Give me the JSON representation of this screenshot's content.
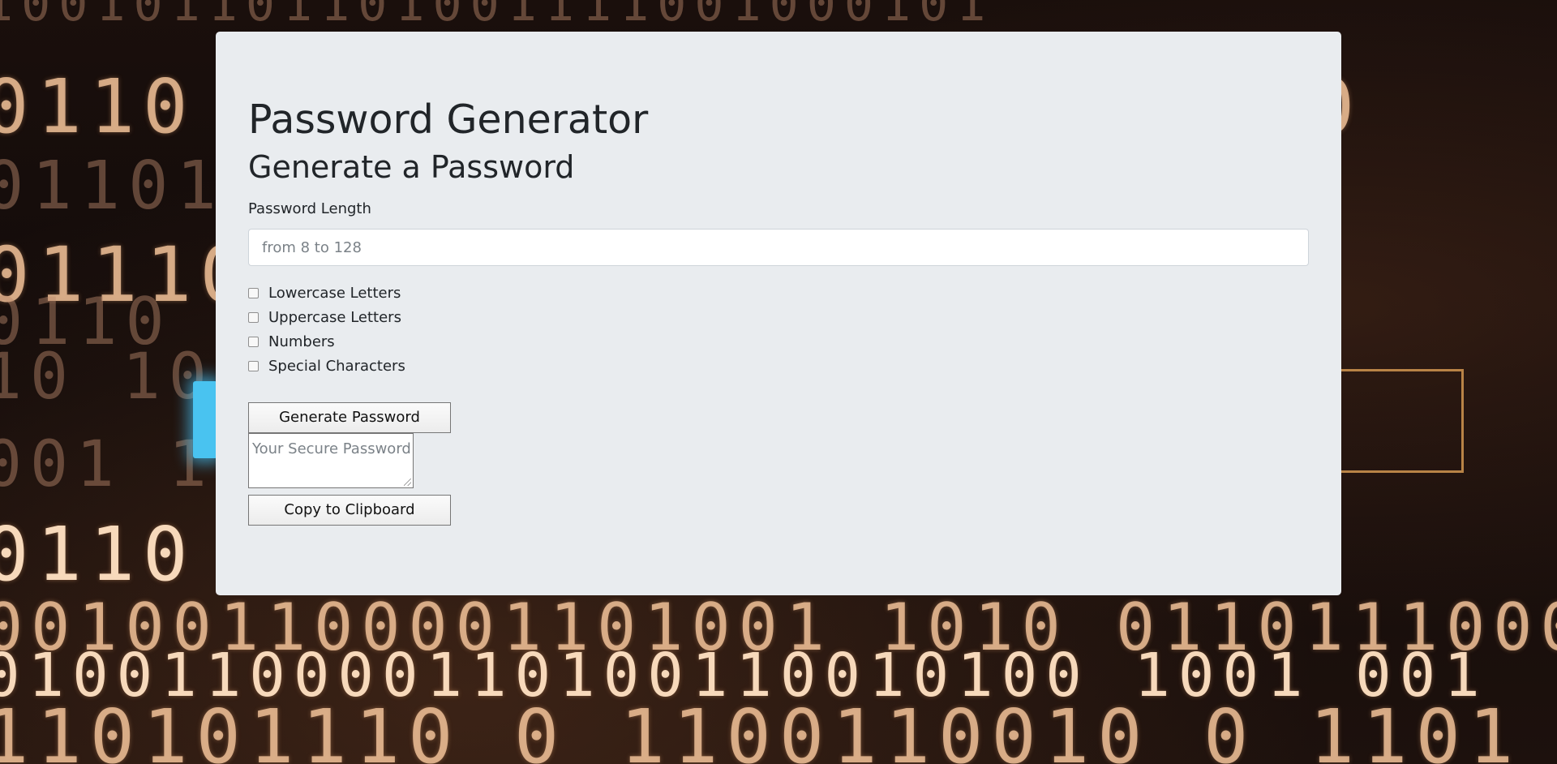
{
  "background": {
    "rows": [
      "100101101101001111001000101",
      "0110   0110  01100010110 0100",
      "01101001   1001101110101",
      "01110011   1001101   10101",
      "0110    001001   01001   001",
      "10    101100   11010",
      "001    100101   11011",
      "0110   01001100111  0011100",
      "001001100001101001 1010 01101110001",
      "0100110000110100110010100 1001 001",
      "110101110 0 1100110010 0 1101"
    ]
  },
  "form": {
    "title": "Password Generator",
    "subtitle": "Generate a Password",
    "length_label": "Password Length",
    "length_placeholder": "from 8 to 128",
    "options": [
      {
        "label": "Lowercase Letters",
        "checked": false
      },
      {
        "label": "Uppercase Letters",
        "checked": false
      },
      {
        "label": "Numbers",
        "checked": false
      },
      {
        "label": "Special Characters",
        "checked": false
      }
    ],
    "generate_label": "Generate Password",
    "output_placeholder": "Your Secure Password",
    "copy_label": "Copy to Clipboard"
  },
  "colors": {
    "card_background": "#e9ecef",
    "text": "#212529",
    "page_background": "#140c0a"
  }
}
